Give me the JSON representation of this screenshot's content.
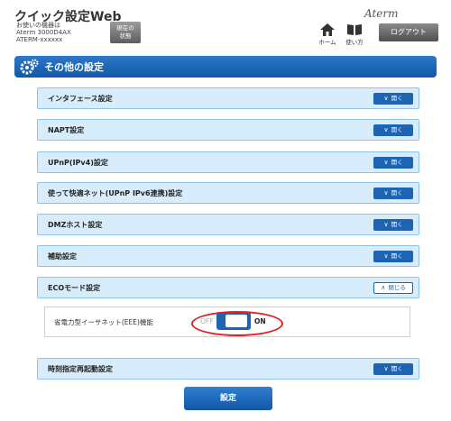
{
  "header": {
    "app_title": "クイック設定Web",
    "device_lines": [
      "お使いの機器は",
      "Aterm 3000D4AX",
      "ATERM-xxxxxx"
    ],
    "status_button": [
      "現在の",
      "状態"
    ],
    "brand": "Aterm",
    "home_label": "ホーム",
    "help_label": "使い方",
    "logout_label": "ログアウト"
  },
  "section": {
    "title": "その他の設定"
  },
  "panels": [
    {
      "label": "インタフェース設定",
      "button": "開く"
    },
    {
      "label": "NAPT設定",
      "button": "開く"
    },
    {
      "label": "UPnP(IPv4)設定",
      "button": "開く"
    },
    {
      "label": "使って快適ネット(UPnP IPv6連携)設定",
      "button": "開く"
    },
    {
      "label": "DMZホスト設定",
      "button": "開く"
    },
    {
      "label": "補助設定",
      "button": "開く"
    },
    {
      "label": "ECOモード設定",
      "button": "閉じる"
    },
    {
      "label": "時刻指定再起動設定",
      "button": "開く"
    }
  ],
  "eco": {
    "setting_label": "省電力型イーサネット(EEE)機能",
    "toggle_off": "OFF",
    "toggle_on": "ON",
    "state": "ON"
  },
  "save_label": "設定",
  "colors": {
    "accent": "#1d64b4",
    "panel_bg": "#d8edfb",
    "highlight": "#e02020"
  }
}
